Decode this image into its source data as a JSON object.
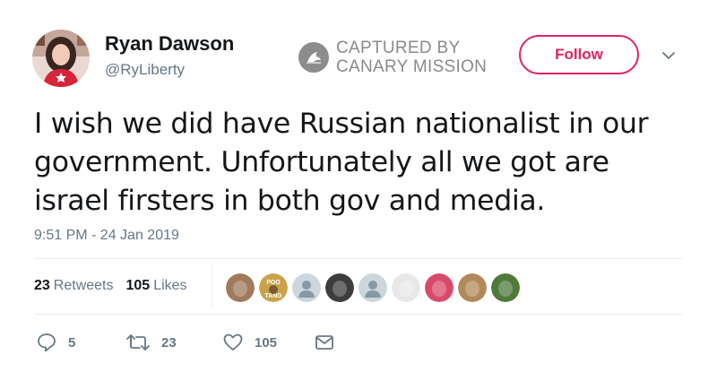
{
  "author": {
    "name": "Ryan Dawson",
    "handle": "@RyLiberty"
  },
  "watermark": {
    "line1": "CAPTURED BY",
    "line2": "CANARY MISSION"
  },
  "follow_label": "Follow",
  "tweet": {
    "text": "I wish we did have Russian nationalist in our government. Unfortunately all we got are israel firsters in both gov and media.",
    "timestamp": "9:51 PM - 24 Jan 2019"
  },
  "stats": {
    "retweets_count": "23",
    "retweets_label": "Retweets",
    "likes_count": "105",
    "likes_label": "Likes"
  },
  "likers": [
    {
      "name": "liker-1",
      "color": "#a07a5a"
    },
    {
      "name": "liker-2",
      "color": "#c9a34a",
      "text_top": "POO",
      "text_bottom": "TANG"
    },
    {
      "name": "liker-3",
      "color": "#ccd6dd"
    },
    {
      "name": "liker-4",
      "color": "#3d3d3d"
    },
    {
      "name": "liker-5",
      "color": "#ccd6dd"
    },
    {
      "name": "liker-6",
      "color": "#e8e8e8"
    },
    {
      "name": "liker-7",
      "color": "#d94a6a"
    },
    {
      "name": "liker-8",
      "color": "#b08a5a"
    },
    {
      "name": "liker-9",
      "color": "#4e7a3a"
    }
  ],
  "actions": {
    "reply_count": "5",
    "retweet_count": "23",
    "like_count": "105"
  },
  "colors": {
    "follow_accent": "#e0245e",
    "muted": "#657786",
    "text": "#14171a",
    "watermark_gray": "#8a8a8a"
  }
}
